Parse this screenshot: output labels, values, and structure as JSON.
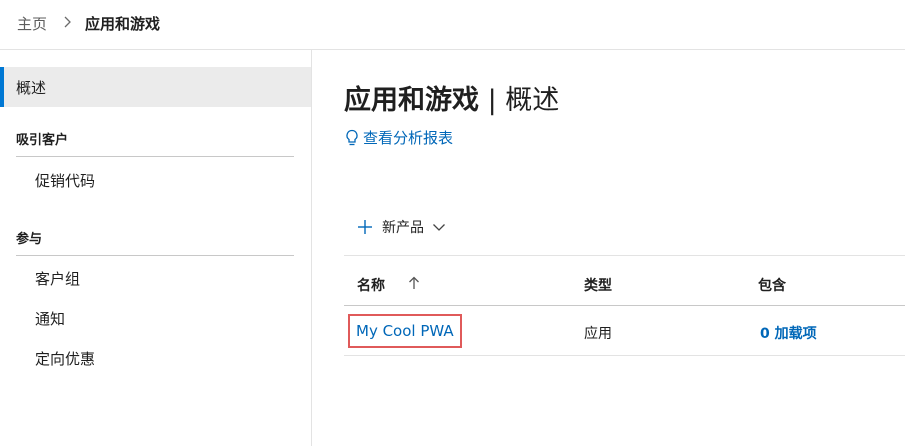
{
  "breadcrumb": {
    "home": "主页",
    "current": "应用和游戏"
  },
  "sidebar": {
    "active_item": "概述",
    "sections": [
      {
        "heading": "吸引客户",
        "items": [
          "促销代码"
        ]
      },
      {
        "heading": "参与",
        "items": [
          "客户组",
          "通知",
          "定向优惠"
        ]
      }
    ]
  },
  "main": {
    "title_bold": "应用和游戏",
    "title_sep": " | ",
    "title_rest": "概述",
    "report_link": "查看分析报表",
    "new_product": "新产品",
    "table": {
      "columns": [
        "名称",
        "类型",
        "包含"
      ],
      "rows": [
        {
          "name": "My Cool PWA",
          "type": "应用",
          "includes": "0 加载项"
        }
      ]
    }
  },
  "colors": {
    "accent": "#0078d4",
    "link": "#0067b8",
    "highlight_border": "#e05a5a"
  }
}
